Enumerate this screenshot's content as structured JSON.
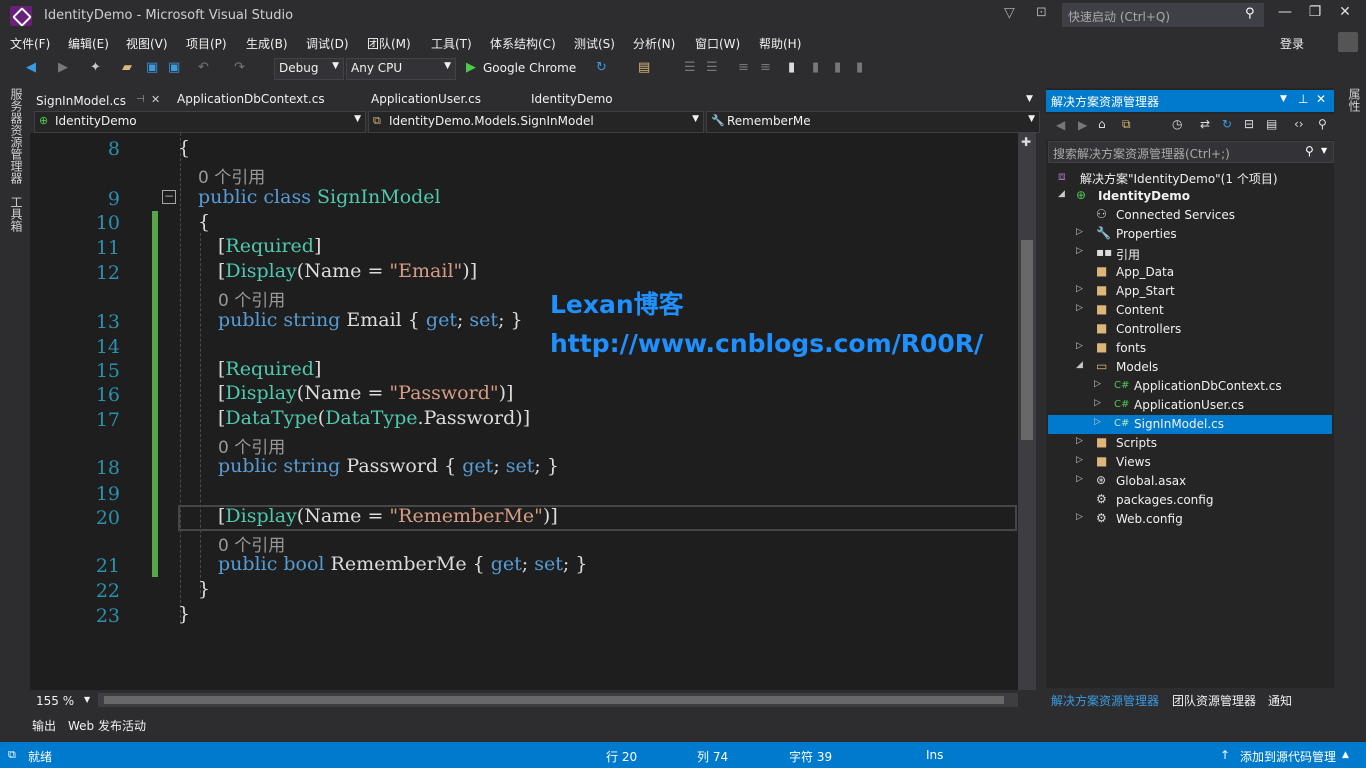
{
  "window": {
    "title": "IdentityDemo - Microsoft Visual Studio"
  },
  "quick_launch": {
    "placeholder": "快速启动 (Ctrl+Q)"
  },
  "menu": [
    "文件(F)",
    "编辑(E)",
    "视图(V)",
    "项目(P)",
    "生成(B)",
    "调试(D)",
    "团队(M)",
    "工具(T)",
    "体系结构(C)",
    "测试(S)",
    "分析(N)",
    "窗口(W)",
    "帮助(H)"
  ],
  "login": "登录",
  "toolbar": {
    "config": "Debug",
    "platform": "Any CPU",
    "run_target": "Google Chrome"
  },
  "left_tabs": [
    "服务器资源管理器",
    "工具箱"
  ],
  "right_tab": "属性",
  "doc_tabs": [
    "SignInModel.cs",
    "ApplicationDbContext.cs",
    "ApplicationUser.cs",
    "IdentityDemo"
  ],
  "nav": {
    "project": "IdentityDemo",
    "type": "IdentityDemo.Models.SignInModel",
    "member": "RememberMe"
  },
  "editor": {
    "line_numbers": [
      "8",
      "9",
      "10",
      "11",
      "12",
      "13",
      "14",
      "15",
      "16",
      "17",
      "18",
      "19",
      "20",
      "21",
      "22",
      "23"
    ],
    "ref_text": "0 个引用",
    "watermark_title": "Lexan博客",
    "watermark_url": "http://www.cnblogs.com/R00R/",
    "zoom": "155 %"
  },
  "bottom_tabs": [
    "输出",
    "Web 发布活动"
  ],
  "status": {
    "ready": "就绪",
    "line": "行 20",
    "col": "列 74",
    "char": "字符 39",
    "mode": "Ins",
    "source_control": "添加到源代码管理"
  },
  "solution_explorer": {
    "title": "解决方案资源管理器",
    "search_placeholder": "搜索解决方案资源管理器(Ctrl+;)",
    "items": [
      {
        "label": "解决方案\"IdentityDemo\"(1 个项目)",
        "icon": "solution-icon"
      },
      {
        "label": "IdentityDemo",
        "icon": "web-project-icon"
      },
      {
        "label": "Connected Services",
        "icon": "connected-services-icon"
      },
      {
        "label": "Properties",
        "icon": "wrench-icon"
      },
      {
        "label": "引用",
        "icon": "references-icon"
      },
      {
        "label": "App_Data",
        "icon": "folder-icon"
      },
      {
        "label": "App_Start",
        "icon": "folder-icon"
      },
      {
        "label": "Content",
        "icon": "folder-icon"
      },
      {
        "label": "Controllers",
        "icon": "folder-icon"
      },
      {
        "label": "fonts",
        "icon": "folder-icon"
      },
      {
        "label": "Models",
        "icon": "folder-open-icon"
      },
      {
        "label": "ApplicationDbContext.cs",
        "icon": "csharp-file-icon"
      },
      {
        "label": "ApplicationUser.cs",
        "icon": "csharp-file-icon"
      },
      {
        "label": "SignInModel.cs",
        "icon": "csharp-file-icon"
      },
      {
        "label": "Scripts",
        "icon": "folder-icon"
      },
      {
        "label": "Views",
        "icon": "folder-icon"
      },
      {
        "label": "Global.asax",
        "icon": "global-asax-icon"
      },
      {
        "label": "packages.config",
        "icon": "config-file-icon"
      },
      {
        "label": "Web.config",
        "icon": "config-file-icon"
      }
    ],
    "bottom_tabs": [
      "解决方案资源管理器",
      "团队资源管理器",
      "通知"
    ]
  },
  "colors": {
    "accent": "#007acc",
    "background": "#2d2d30",
    "editor": "#1e1e1e",
    "keyword": "#569cd6",
    "type": "#4ec9b0",
    "string": "#d69d85",
    "line_number": "#2b91af"
  }
}
